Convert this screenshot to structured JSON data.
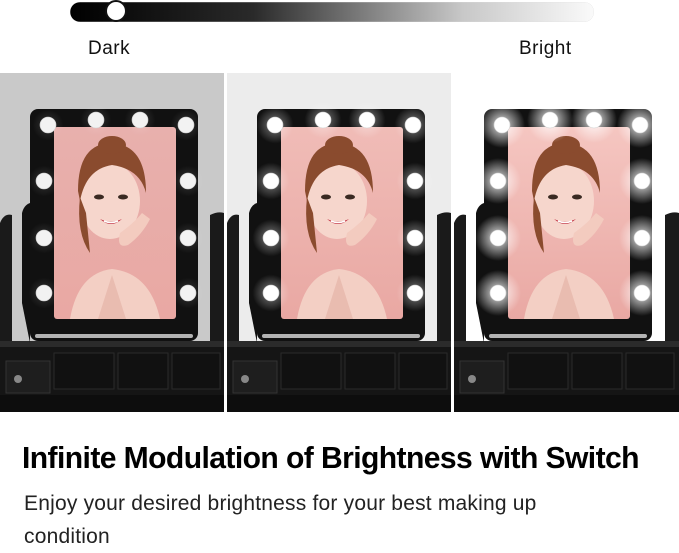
{
  "slider": {
    "min_label": "Dark",
    "max_label": "Bright",
    "level": 0.07
  },
  "panels": [
    {
      "brightness": "dark"
    },
    {
      "brightness": "medium"
    },
    {
      "brightness": "bright"
    }
  ],
  "colors": {
    "frame": "#111111",
    "bulb": "#ffffff",
    "mirror_skin": "#f0b8b4",
    "hair": "#8a4b2e"
  },
  "headline": "Infinite Modulation of Brightness with Switch",
  "subtext": "Enjoy your desired brightness for your best making up condition"
}
